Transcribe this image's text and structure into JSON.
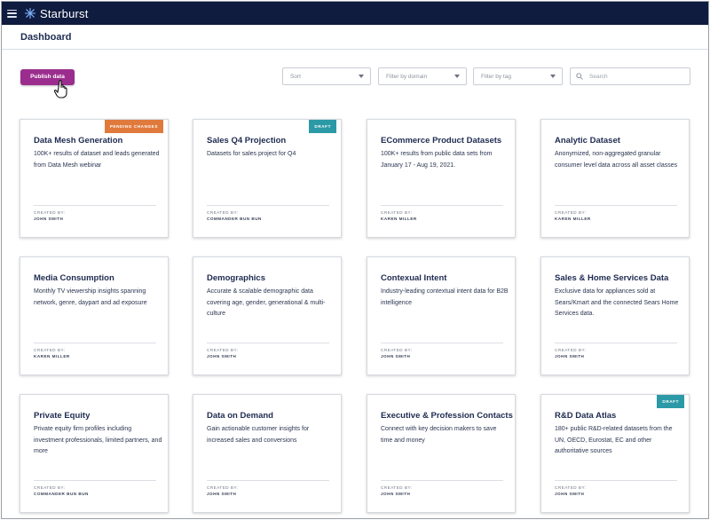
{
  "app": {
    "brand": "Starburst"
  },
  "page": {
    "title": "Dashboard"
  },
  "toolbar": {
    "publish_label": "Publish data",
    "sort_label": "Sort",
    "domain_label": "Filter by domain",
    "tag_label": "Filter by tag",
    "search_placeholder": "Search"
  },
  "colors": {
    "topbar": "#0f1c3f",
    "publish_button": "#9b2d8e",
    "badge_pending": "#e07a3c",
    "badge_draft": "#2b9aa6"
  },
  "icons": {
    "menu": "hamburger-menu-icon",
    "logo": "starburst-logo-icon",
    "search": "search-icon",
    "cursor": "hand-pointer-icon",
    "chevron": "chevron-down-icon"
  },
  "created_by_label": "CREATED BY:",
  "cards": [
    {
      "title": "Data Mesh Generation",
      "desc": "100K+ results of dataset and leads generated from Data Mesh webinar",
      "creator": "JOHN SMITH",
      "badge": "PENDING CHANGES",
      "badge_type": "pending"
    },
    {
      "title": "Sales Q4 Projection",
      "desc": "Datasets for sales project for Q4",
      "creator": "COMMANDER BUN BUN",
      "badge": "DRAFT",
      "badge_type": "draft"
    },
    {
      "title": "ECommerce Product Datasets",
      "desc": "100K+ results from public data sets from January 17 - Aug 19, 2021.",
      "creator": "KAREN MILLER",
      "badge": "",
      "badge_type": ""
    },
    {
      "title": "Analytic  Dataset",
      "desc": "Anonymized, non-aggregated granular consumer level data across all asset classes",
      "creator": "KAREN MILLER",
      "badge": "",
      "badge_type": ""
    },
    {
      "title": "Media Consumption",
      "desc": "Monthly TV viewership insights spanning network, genre, daypart and ad exposure",
      "creator": "KAREN MILLER",
      "badge": "",
      "badge_type": ""
    },
    {
      "title": "Demographics",
      "desc": "Accurate & scalable demographic data covering age, gender, generational & multi-culture",
      "creator": "JOHN SMITH",
      "badge": "",
      "badge_type": ""
    },
    {
      "title": "Contexual Intent",
      "desc": "Industry-leading contextual intent data for B2B intelligence",
      "creator": "JOHN SMITH",
      "badge": "",
      "badge_type": ""
    },
    {
      "title": "Sales & Home Services Data",
      "desc": "Exclusive data for appliances sold at Sears/Kmart and the connected Sears Home Services data.",
      "creator": "JOHN SMITH",
      "badge": "",
      "badge_type": ""
    },
    {
      "title": "Private Equity",
      "desc": "Private equity firm profiles including investment professionals, limited partners, and more",
      "creator": "COMMANDER BUN BUN",
      "badge": "",
      "badge_type": ""
    },
    {
      "title": "Data on Demand",
      "desc": "Gain actionable customer insights for increased sales and conversions",
      "creator": "JOHN SMITH",
      "badge": "",
      "badge_type": ""
    },
    {
      "title": "Executive & Profession Contacts",
      "desc": "Connect with key decision makers to save time and money",
      "creator": "JOHN SMITH",
      "badge": "",
      "badge_type": ""
    },
    {
      "title": "R&D Data Atlas",
      "desc": "180+ public R&D-related datasets from the UN, OECD, Eurostat, EC and other authoritative sources",
      "creator": "JOHN SMITH",
      "badge": "DRAFT",
      "badge_type": "draft"
    }
  ]
}
